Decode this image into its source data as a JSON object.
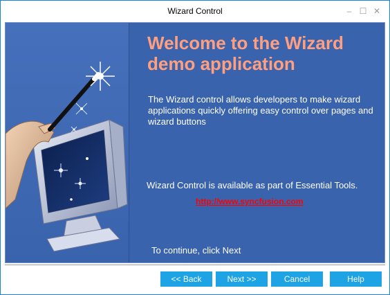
{
  "window": {
    "title": "Wizard Control",
    "controls": {
      "minimize": "‒",
      "maximize": "☐",
      "close": "✕"
    }
  },
  "main": {
    "heading": "Welcome to the Wizard demo application",
    "description": "The Wizard control allows developers to make wizard applications quickly offering easy control over pages and wizard buttons",
    "availability": "Wizard Control is available as part of Essential Tools.",
    "link": "http://www.syncfusion.com",
    "continue_text": "To continue, click Next"
  },
  "buttons": {
    "back": "<< Back",
    "next": "Next >>",
    "cancel": "Cancel",
    "help": "Help"
  },
  "colors": {
    "panel_blue": "#3a63ad",
    "heading_color": "#ff9f80",
    "link_color": "#ff0000",
    "button_blue": "#1ea3e4"
  },
  "icons": {
    "illustration": "magic-wand-monitor-illustration"
  }
}
